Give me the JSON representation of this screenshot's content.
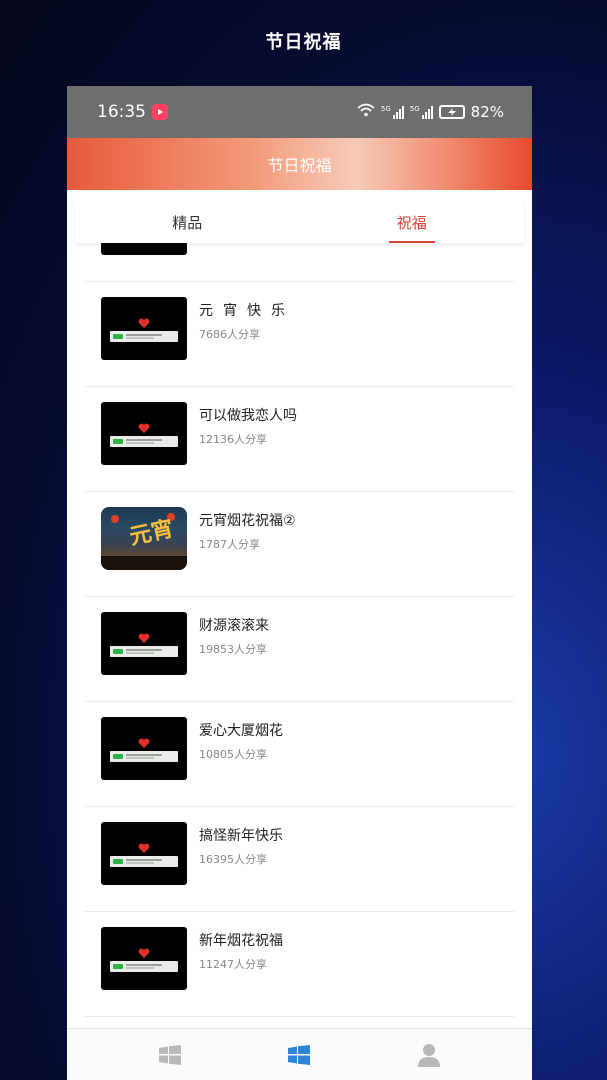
{
  "outer_title": "节日祝福",
  "status_bar": {
    "time": "16:35",
    "battery": "82%",
    "network1": "5G",
    "network2": "5G"
  },
  "header": {
    "title": "节日祝福"
  },
  "tabs": [
    {
      "label": "精品",
      "active": false
    },
    {
      "label": "祝福",
      "active": true
    }
  ],
  "items": [
    {
      "title": "元宵快乐",
      "count": "7686人分享",
      "thumb": "video-heart"
    },
    {
      "title": "可以做我恋人吗",
      "count": "12136人分享",
      "thumb": "video-heart"
    },
    {
      "title": "元宵烟花祝福②",
      "count": "1787人分享",
      "thumb": "yuanxiao-poster"
    },
    {
      "title": "财源滚滚来",
      "count": "19853人分享",
      "thumb": "video-heart"
    },
    {
      "title": "爱心大厦烟花",
      "count": "10805人分享",
      "thumb": "video-heart"
    },
    {
      "title": "搞怪新年快乐",
      "count": "16395人分享",
      "thumb": "video-heart"
    },
    {
      "title": "新年烟花祝福",
      "count": "11247人分享",
      "thumb": "video-heart"
    }
  ],
  "poster_text": "元宵",
  "bottom_nav": [
    {
      "icon": "windows-grid-icon",
      "active": false
    },
    {
      "icon": "windows-grid-icon",
      "active": true
    },
    {
      "icon": "user-icon",
      "active": false
    }
  ],
  "colors": {
    "accent": "#d9443a",
    "nav_active": "#2f86d9",
    "nav_inactive": "#b8b8b8"
  }
}
